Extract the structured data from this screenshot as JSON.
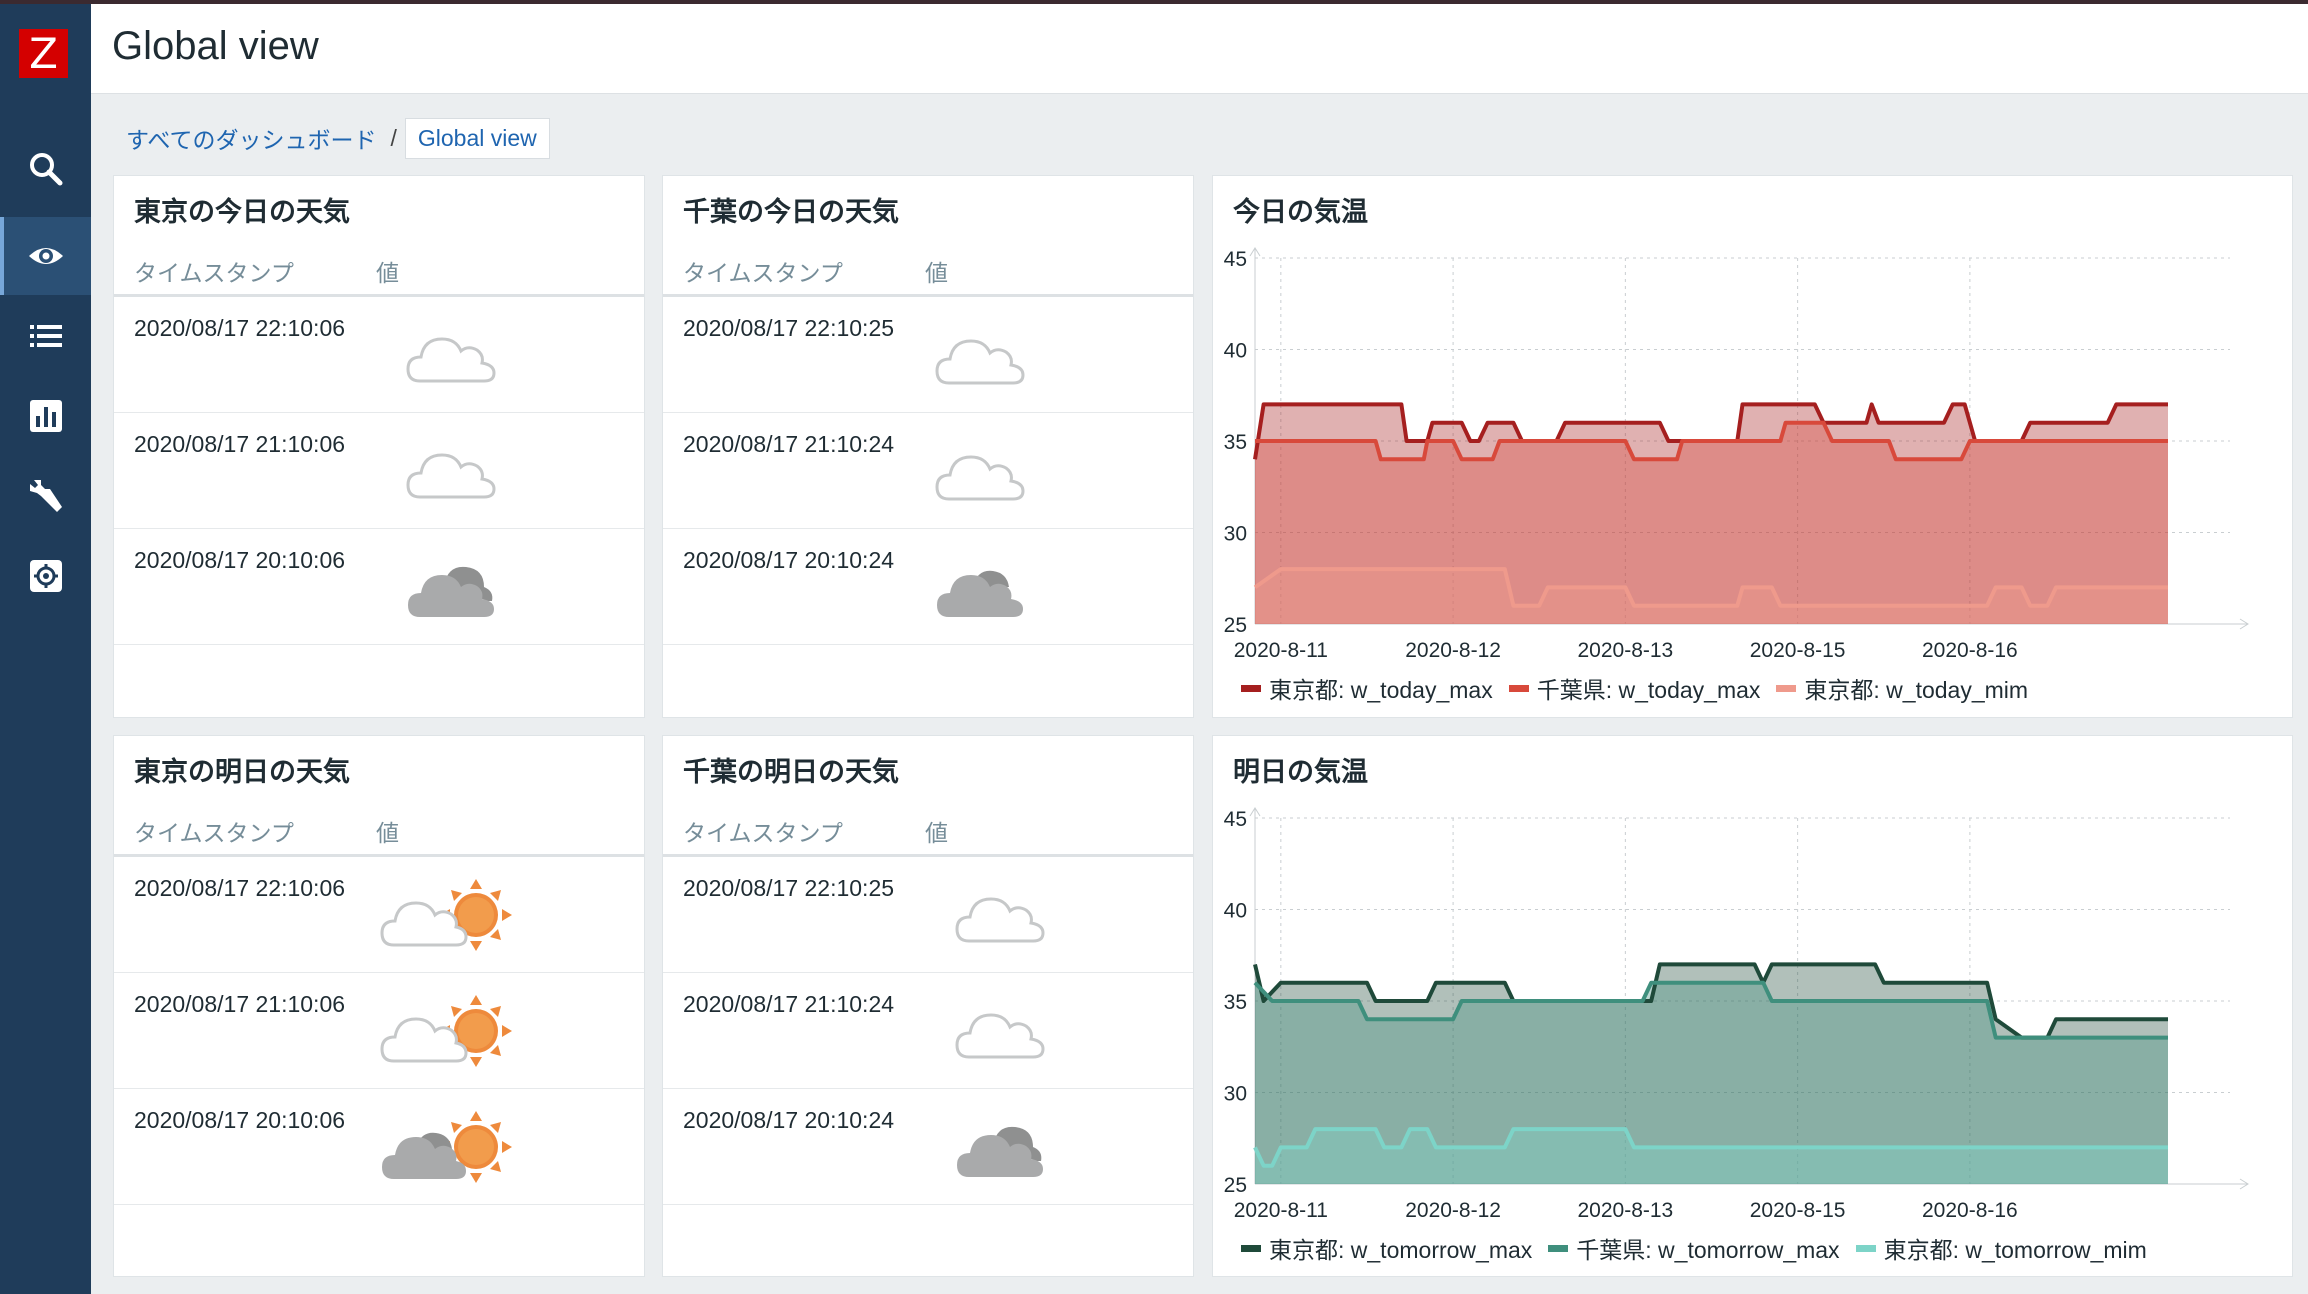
{
  "app": {
    "logo": "Z",
    "title": "Global view"
  },
  "sidebar": {
    "items": [
      {
        "icon": "search-icon"
      },
      {
        "icon": "eye-icon",
        "active": true
      },
      {
        "icon": "list-icon"
      },
      {
        "icon": "report-icon"
      },
      {
        "icon": "wrench-icon"
      },
      {
        "icon": "gear-icon"
      }
    ]
  },
  "breadcrumb": {
    "all": "すべてのダッシュボード",
    "sep": "/",
    "current": "Global view"
  },
  "columns": {
    "timestamp": "タイムスタンプ",
    "value": "値"
  },
  "widgets": {
    "tokyo_today": {
      "title": "東京の今日の天気",
      "rows": [
        {
          "ts": "2020/08/17 22:10:06",
          "icon": "cloud-icon"
        },
        {
          "ts": "2020/08/17 21:10:06",
          "icon": "cloud-icon"
        },
        {
          "ts": "2020/08/17 20:10:06",
          "icon": "dark-cloud-icon"
        }
      ]
    },
    "chiba_today": {
      "title": "千葉の今日の天気",
      "rows": [
        {
          "ts": "2020/08/17 22:10:25",
          "icon": "cloud-moon-icon"
        },
        {
          "ts": "2020/08/17 21:10:24",
          "icon": "cloud-moon-icon"
        },
        {
          "ts": "2020/08/17 20:10:24",
          "icon": "dark-cloud-moon-icon"
        }
      ]
    },
    "tokyo_tomorrow": {
      "title": "東京の明日の天気",
      "rows": [
        {
          "ts": "2020/08/17 22:10:06",
          "icon": "cloud-sun-icon"
        },
        {
          "ts": "2020/08/17 21:10:06",
          "icon": "cloud-sun-icon"
        },
        {
          "ts": "2020/08/17 20:10:06",
          "icon": "dark-cloud-sun-icon"
        }
      ]
    },
    "chiba_tomorrow": {
      "title": "千葉の明日の天気",
      "rows": [
        {
          "ts": "2020/08/17 22:10:25",
          "icon": "cloud-icon"
        },
        {
          "ts": "2020/08/17 21:10:24",
          "icon": "cloud-icon"
        },
        {
          "ts": "2020/08/17 20:10:24",
          "icon": "dark-cloud-icon"
        }
      ]
    }
  },
  "charts": {
    "today_title": "今日の気温",
    "tomorrow_title": "明日の気温"
  },
  "chart_data": [
    {
      "type": "area",
      "title": "今日の気温",
      "ylim": [
        25,
        45
      ],
      "yticks": [
        25,
        30,
        35,
        40,
        45
      ],
      "xlim": [
        0,
        5.66
      ],
      "xticks": [
        {
          "pos": 0.15,
          "label": "2020-8-11"
        },
        {
          "pos": 1.15,
          "label": "2020-8-12"
        },
        {
          "pos": 2.15,
          "label": "2020-8-13"
        },
        {
          "pos": 3.15,
          "label": "2020-8-15"
        },
        {
          "pos": 4.15,
          "label": "2020-8-16"
        }
      ],
      "series": [
        {
          "name": "東京都: w_today_max",
          "color": "#a51f1f",
          "points": [
            [
              0,
              34
            ],
            [
              0.05,
              37
            ],
            [
              0.85,
              37
            ],
            [
              0.88,
              35
            ],
            [
              1.0,
              35
            ],
            [
              1.03,
              36
            ],
            [
              1.2,
              36
            ],
            [
              1.25,
              35
            ],
            [
              1.3,
              35
            ],
            [
              1.35,
              36
            ],
            [
              1.5,
              36
            ],
            [
              1.55,
              35
            ],
            [
              1.75,
              35
            ],
            [
              1.8,
              36
            ],
            [
              2.15,
              36
            ],
            [
              2.35,
              36
            ],
            [
              2.4,
              35
            ],
            [
              2.8,
              35
            ],
            [
              2.83,
              37
            ],
            [
              3.25,
              37
            ],
            [
              3.3,
              36
            ],
            [
              3.55,
              36
            ],
            [
              3.58,
              37
            ],
            [
              3.62,
              36
            ],
            [
              4.0,
              36
            ],
            [
              4.05,
              37
            ],
            [
              4.12,
              37
            ],
            [
              4.18,
              35
            ],
            [
              4.45,
              35
            ],
            [
              4.5,
              36
            ],
            [
              4.95,
              36
            ],
            [
              5.0,
              37
            ],
            [
              5.3,
              37
            ]
          ]
        },
        {
          "name": "千葉県: w_today_max",
          "color": "#d8493b",
          "points": [
            [
              0,
              35
            ],
            [
              0.7,
              35
            ],
            [
              0.73,
              34
            ],
            [
              0.98,
              34
            ],
            [
              1.0,
              35
            ],
            [
              1.15,
              35
            ],
            [
              1.2,
              34
            ],
            [
              1.38,
              34
            ],
            [
              1.42,
              35
            ],
            [
              2.15,
              35
            ],
            [
              2.2,
              34
            ],
            [
              2.45,
              34
            ],
            [
              2.48,
              35
            ],
            [
              3.05,
              35
            ],
            [
              3.08,
              36
            ],
            [
              3.3,
              36
            ],
            [
              3.35,
              35
            ],
            [
              3.68,
              35
            ],
            [
              3.72,
              34
            ],
            [
              4.1,
              34
            ],
            [
              4.15,
              35
            ],
            [
              5.3,
              35
            ]
          ]
        },
        {
          "name": "東京都: w_today_mim",
          "color": "#ef9a8c",
          "points": [
            [
              0,
              27
            ],
            [
              0.15,
              28
            ],
            [
              0.8,
              28
            ],
            [
              1.45,
              28
            ],
            [
              1.5,
              26
            ],
            [
              1.65,
              26
            ],
            [
              1.7,
              27
            ],
            [
              2.15,
              27
            ],
            [
              2.2,
              26
            ],
            [
              2.8,
              26
            ],
            [
              2.83,
              27
            ],
            [
              3.0,
              27
            ],
            [
              3.05,
              26
            ],
            [
              4.25,
              26
            ],
            [
              4.3,
              27
            ],
            [
              4.45,
              27
            ],
            [
              4.5,
              26
            ],
            [
              4.6,
              26
            ],
            [
              4.65,
              27
            ],
            [
              5.3,
              27
            ]
          ]
        }
      ]
    },
    {
      "type": "area",
      "title": "明日の気温",
      "ylim": [
        25,
        45
      ],
      "yticks": [
        25,
        30,
        35,
        40,
        45
      ],
      "xlim": [
        0,
        5.66
      ],
      "xticks": [
        {
          "pos": 0.15,
          "label": "2020-8-11"
        },
        {
          "pos": 1.15,
          "label": "2020-8-12"
        },
        {
          "pos": 2.15,
          "label": "2020-8-13"
        },
        {
          "pos": 3.15,
          "label": "2020-8-15"
        },
        {
          "pos": 4.15,
          "label": "2020-8-16"
        }
      ],
      "series": [
        {
          "name": "東京都: w_tomorrow_max",
          "color": "#1f4a3a",
          "points": [
            [
              0,
              37
            ],
            [
              0.05,
              35
            ],
            [
              0.15,
              36
            ],
            [
              0.65,
              36
            ],
            [
              0.7,
              35
            ],
            [
              1.0,
              35
            ],
            [
              1.05,
              36
            ],
            [
              1.45,
              36
            ],
            [
              1.5,
              35
            ],
            [
              2.15,
              35
            ],
            [
              2.3,
              35
            ],
            [
              2.35,
              37
            ],
            [
              2.9,
              37
            ],
            [
              2.95,
              36
            ],
            [
              3.0,
              37
            ],
            [
              3.6,
              37
            ],
            [
              3.65,
              36
            ],
            [
              4.25,
              36
            ],
            [
              4.3,
              34
            ],
            [
              4.45,
              33
            ],
            [
              4.6,
              33
            ],
            [
              4.65,
              34
            ],
            [
              5.3,
              34
            ]
          ]
        },
        {
          "name": "千葉県: w_tomorrow_max",
          "color": "#3f8f7d",
          "points": [
            [
              0,
              36
            ],
            [
              0.1,
              35
            ],
            [
              0.6,
              35
            ],
            [
              0.65,
              34
            ],
            [
              1.15,
              34
            ],
            [
              1.2,
              35
            ],
            [
              2.25,
              35
            ],
            [
              2.3,
              36
            ],
            [
              2.95,
              36
            ],
            [
              3.0,
              35
            ],
            [
              4.25,
              35
            ],
            [
              4.3,
              33
            ],
            [
              5.3,
              33
            ]
          ]
        },
        {
          "name": "東京都: w_tomorrow_mim",
          "color": "#7dd4c8",
          "points": [
            [
              0,
              27
            ],
            [
              0.05,
              26
            ],
            [
              0.1,
              26
            ],
            [
              0.15,
              27
            ],
            [
              0.3,
              27
            ],
            [
              0.35,
              28
            ],
            [
              0.7,
              28
            ],
            [
              0.75,
              27
            ],
            [
              0.85,
              27
            ],
            [
              0.9,
              28
            ],
            [
              1.0,
              28
            ],
            [
              1.05,
              27
            ],
            [
              1.45,
              27
            ],
            [
              1.5,
              28
            ],
            [
              2.15,
              28
            ],
            [
              2.2,
              27
            ],
            [
              5.3,
              27
            ]
          ]
        }
      ]
    }
  ]
}
